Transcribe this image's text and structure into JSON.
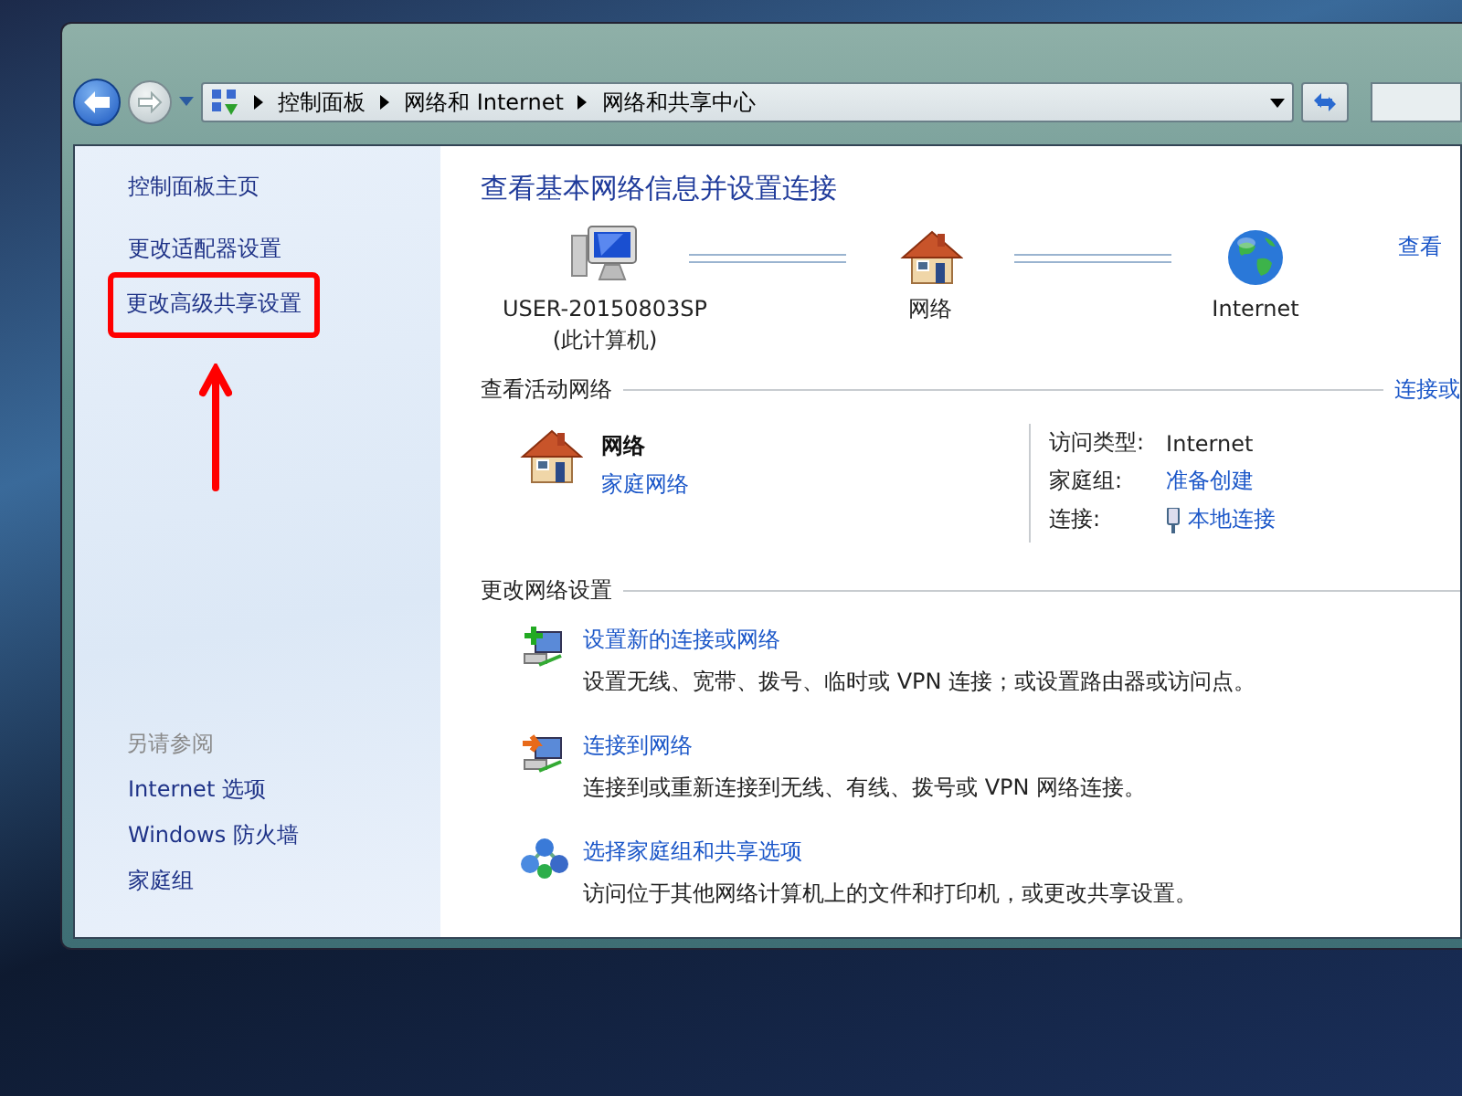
{
  "address_bar": {
    "breadcrumbs": [
      "控制面板",
      "网络和 Internet",
      "网络和共享中心"
    ]
  },
  "sidebar": {
    "items": [
      {
        "label": "控制面板主页",
        "highlighted": false
      },
      {
        "label": "更改适配器设置",
        "highlighted": false
      },
      {
        "label": "更改高级共享设置",
        "highlighted": true
      }
    ],
    "see_also_title": "另请参阅",
    "see_also": [
      "Internet 选项",
      "Windows 防火墙",
      "家庭组"
    ]
  },
  "main": {
    "title": "查看基本网络信息并设置连接",
    "map_link": "查看",
    "network_map": [
      {
        "kind": "computer",
        "label": "USER-20150803SP",
        "sublabel": "(此计算机)"
      },
      {
        "kind": "house",
        "label": "网络"
      },
      {
        "kind": "globe",
        "label": "Internet"
      }
    ],
    "active_networks": {
      "heading": "查看活动网络",
      "link": "连接或",
      "network": {
        "name": "网络",
        "type": "家庭网络"
      },
      "properties": [
        {
          "kind": "text",
          "label": "访问类型:",
          "value": "Internet"
        },
        {
          "kind": "link",
          "label": "家庭组:",
          "value": "准备创建"
        },
        {
          "kind": "connection",
          "label": "连接:",
          "value": "本地连接"
        }
      ]
    },
    "change_settings": {
      "heading": "更改网络设置",
      "tasks": [
        {
          "kind": "new-connection",
          "title": "设置新的连接或网络",
          "description": "设置无线、宽带、拨号、临时或 VPN 连接；或设置路由器或访问点。"
        },
        {
          "kind": "connect",
          "title": "连接到网络",
          "description": "连接到或重新连接到无线、有线、拨号或 VPN 网络连接。"
        },
        {
          "kind": "homegroup",
          "title": "选择家庭组和共享选项",
          "description": "访问位于其他网络计算机上的文件和打印机，或更改共享设置。"
        }
      ]
    }
  }
}
